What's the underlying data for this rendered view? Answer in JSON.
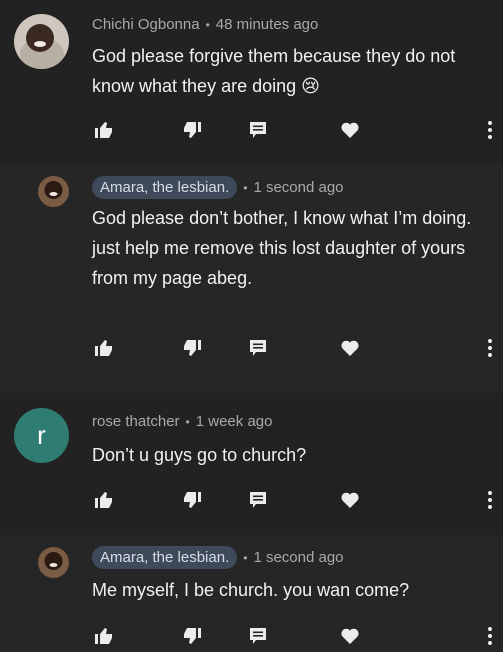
{
  "comments": [
    {
      "author": "Chichi Ogbonna",
      "author_badge": false,
      "time": "48 minutes ago",
      "text": "God please forgive them because they do not know what they are doing 😢",
      "avatar_letter": ""
    },
    {
      "author": "Amara, the lesbian.",
      "author_badge": true,
      "time": "1 second ago",
      "text": "God please don’t bother, I know what I’m doing.\njust help me remove this lost daughter of yours from my page abeg.",
      "avatar_letter": ""
    },
    {
      "author": "rose thatcher",
      "author_badge": false,
      "time": "1 week ago",
      "text": "Don’t u guys go to church?",
      "avatar_letter": "r"
    },
    {
      "author": "Amara, the lesbian.",
      "author_badge": true,
      "time": "1 second ago",
      "text": "Me myself, I be church. you wan come?",
      "avatar_letter": ""
    }
  ],
  "separator": "•",
  "colors": {
    "background": "#1f1f1f",
    "badge": "#3e4a5a",
    "avatar_rose": "#2f7d72"
  },
  "icons": [
    "thumbs-up-icon",
    "thumbs-down-icon",
    "reply-icon",
    "heart-icon",
    "more-vert-icon"
  ]
}
